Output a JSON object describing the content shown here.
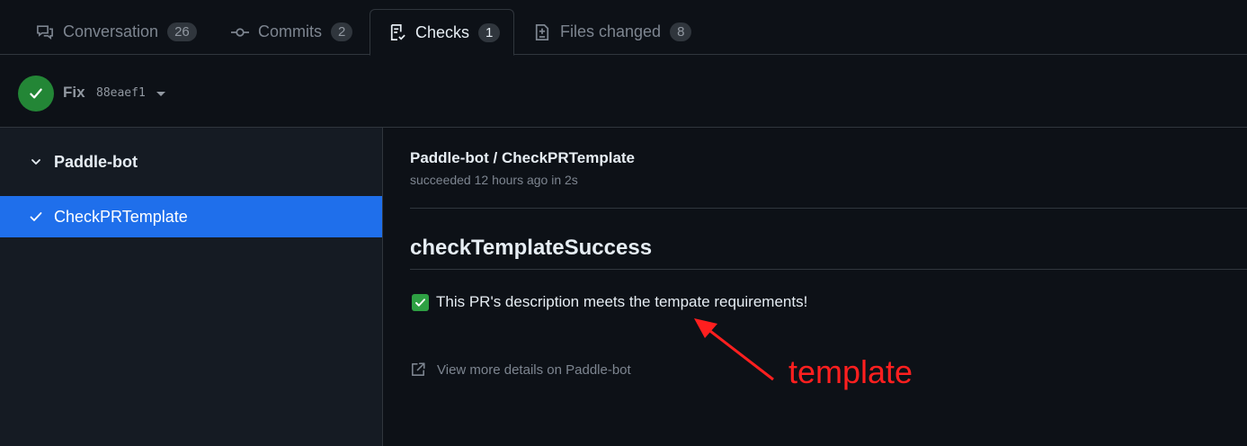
{
  "tabs": [
    {
      "label": "Conversation",
      "count": "26"
    },
    {
      "label": "Commits",
      "count": "2"
    },
    {
      "label": "Checks",
      "count": "1"
    },
    {
      "label": "Files changed",
      "count": "8"
    }
  ],
  "commit": {
    "title": "Fix",
    "sha": "88eaef1"
  },
  "sidebar": {
    "group": "Paddle-bot",
    "items": [
      {
        "label": "CheckPRTemplate",
        "selected": true
      }
    ]
  },
  "main": {
    "title": "Paddle-bot / CheckPRTemplate",
    "subtitle": "succeeded 12 hours ago in 2s",
    "section_heading": "checkTemplateSuccess",
    "result_text": "This PR's description meets the tempate requirements!",
    "details_link": "View more details on Paddle-bot"
  },
  "annotation": {
    "text": "template",
    "color": "#ff1f1f"
  },
  "colors": {
    "accent": "#1f6feb",
    "success": "#238636"
  }
}
